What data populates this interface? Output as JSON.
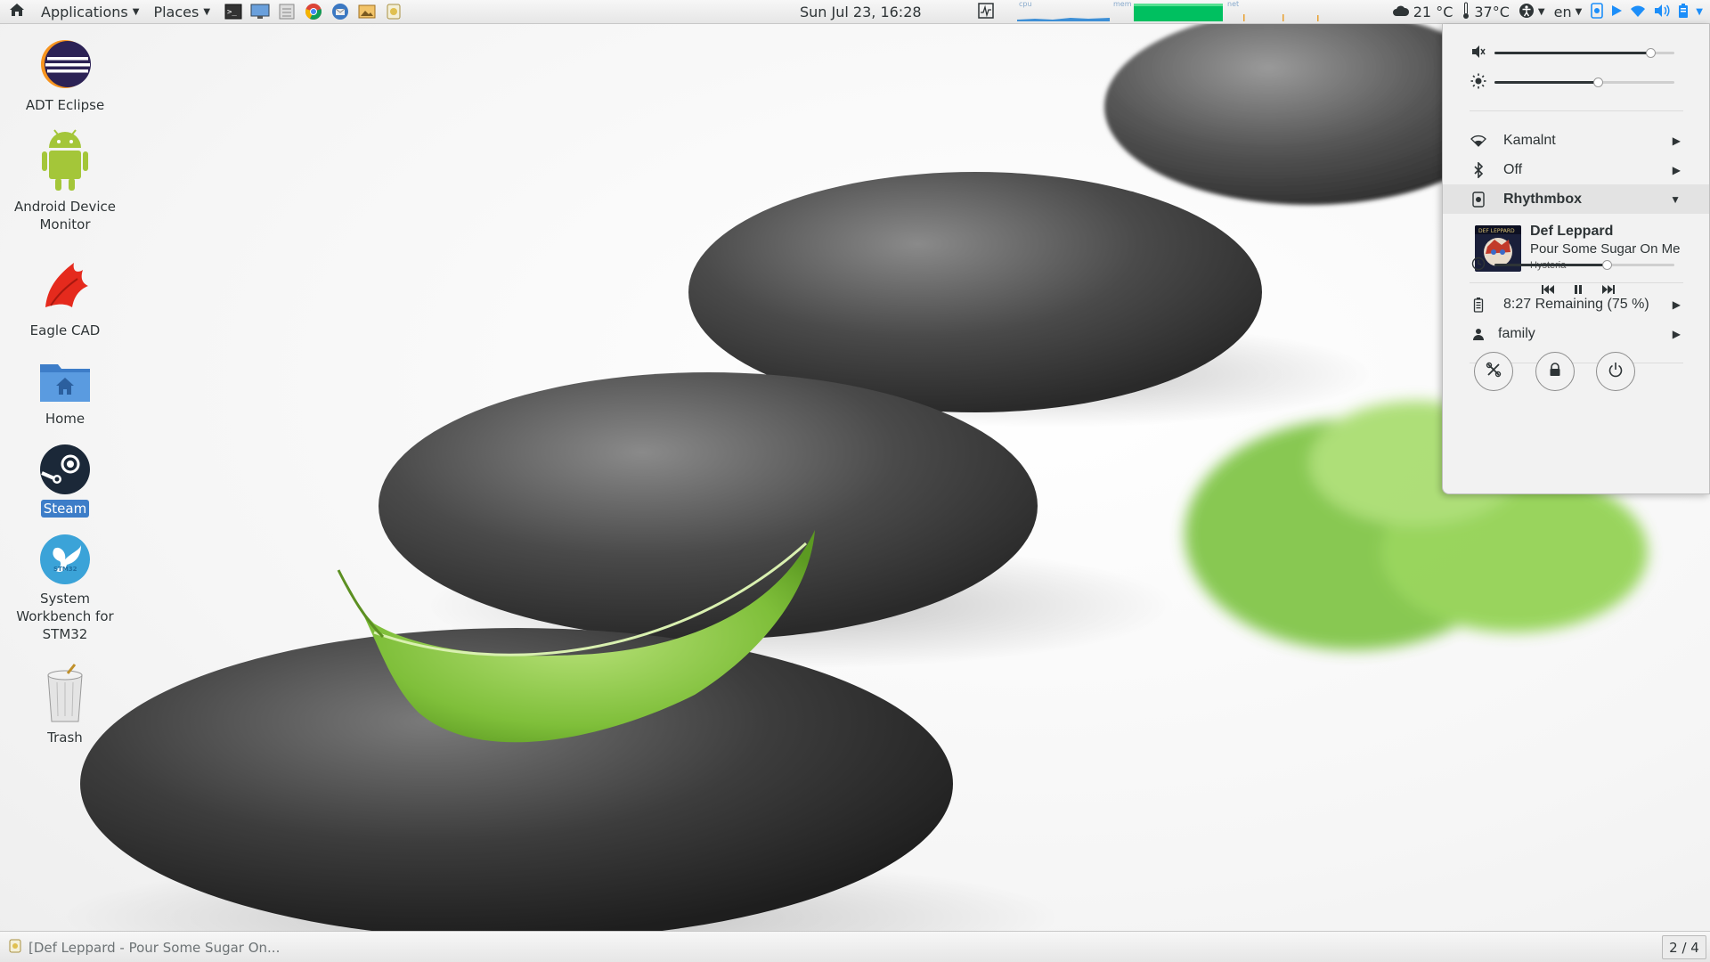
{
  "top_panel": {
    "applications_label": "Applications",
    "places_label": "Places",
    "launchers": [
      "terminal-icon",
      "display-icon",
      "file-manager-icon",
      "chrome-icon",
      "thunderbird-icon",
      "image-viewer-icon",
      "rhythmbox-icon"
    ],
    "clock": "Sun Jul 23, 16:28",
    "monitors": {
      "cpu_label": "cpu",
      "mem_label": "mem",
      "net_label": "net"
    },
    "weather": "21 °C",
    "temperature": "37°C",
    "keyboard_layout": "en"
  },
  "desktop_icons": [
    {
      "label": "ADT Eclipse",
      "icon": "eclipse-icon"
    },
    {
      "label": "Android Device Monitor",
      "icon": "android-icon"
    },
    {
      "label": "Eagle CAD",
      "icon": "eagle-icon"
    },
    {
      "label": "Home",
      "icon": "home-folder-icon"
    },
    {
      "label": "Steam",
      "icon": "steam-icon"
    },
    {
      "label": "System Workbench for STM32",
      "icon": "stm32-icon"
    },
    {
      "label": "Trash",
      "icon": "trash-icon"
    }
  ],
  "system_menu": {
    "volume_level": 0.87,
    "brightness_level": 0.58,
    "wifi_label": "Kamalnt",
    "bluetooth_label": "Off",
    "media_player_label": "Rhythmbox",
    "track": {
      "artist": "Def Leppard",
      "title": "Pour Some Sugar On Me",
      "album": "Hysteria",
      "art_label": "DEF LEPPARD"
    },
    "track_position": 0.63,
    "battery_label": "8:27 Remaining (75 %)",
    "user_label": "family"
  },
  "bottom_panel": {
    "task_label": "[Def Leppard - Pour Some Sugar On...",
    "workspace": "2 / 4"
  },
  "colors": {
    "selection": "#3d7dc8",
    "mem_graph": "#00c060",
    "cpu_graph": "#3d8fd6",
    "accent": "#2e3436"
  }
}
